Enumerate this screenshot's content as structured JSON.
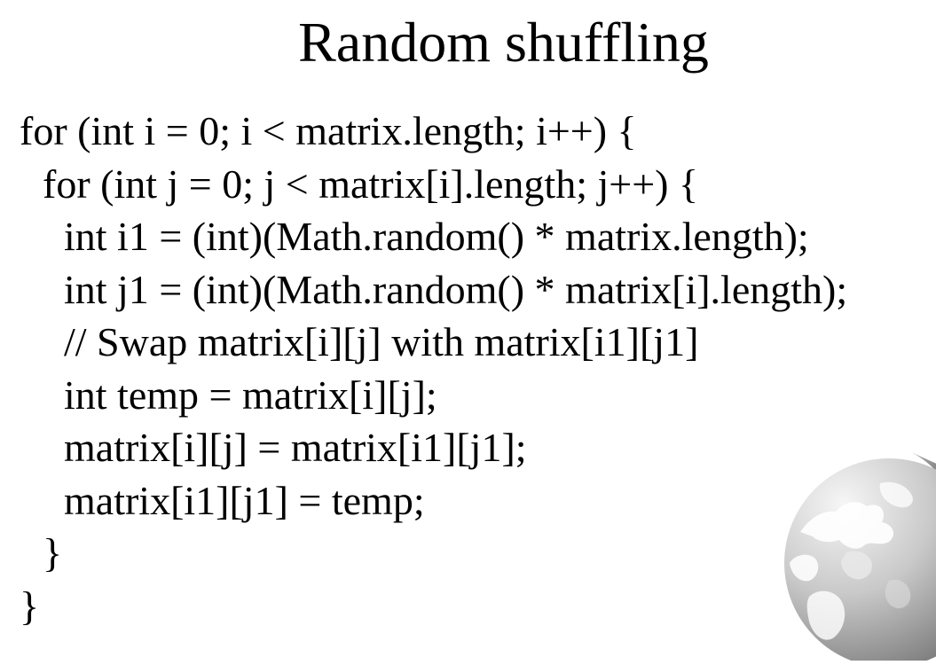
{
  "slide": {
    "title": "Random shuffling",
    "code_lines": [
      "for (int i = 0; i < matrix.length; i++) {",
      "for (int j = 0; j < matrix[i].length; j++) {",
      "int i1 = (int)(Math.random() * matrix.length);",
      "int j1 = (int)(Math.random() * matrix[i].length);",
      "// Swap matrix[i][j] with matrix[i1][j1]",
      "int temp = matrix[i][j];",
      "matrix[i][j] = matrix[i1][j1];",
      "matrix[i1][j1] = temp;",
      "}",
      "}"
    ],
    "decoration": {
      "icon": "globe-icon",
      "colors": {
        "globe_light": "#f4f4f4",
        "globe_dark": "#8a8a8a",
        "land": "#ffffff",
        "rim": "#555555"
      }
    }
  }
}
